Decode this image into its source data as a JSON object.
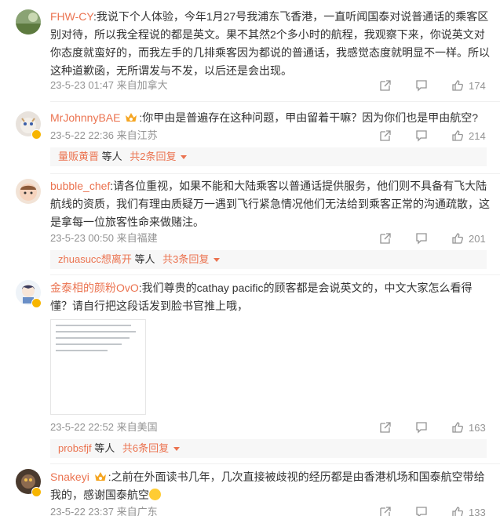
{
  "comments": [
    {
      "username": "FHW-CY",
      "text": ":我说下个人体验，今年1月27号我浦东飞香港，一直听闻国泰对说普通话的乘客区别对待，所以我全程说的都是英文。果不其然2个多小时的航程，我观察下来，你说英文对你态度就蛮好的，而我左手的几排乘客因为都说的普通话，我感觉态度就明显不一样。所以这种道歉函，无所谓发与不发，以后还是会出现。",
      "time": "23-5-23 01:47",
      "location": "来自加拿大",
      "likes": "174"
    },
    {
      "username": "MrJohnnyBAE",
      "text": ":你甲由是普遍存在这种问题，甲由留着干嘛？因为你们也是甲由航空?",
      "time": "23-5-22 22:36",
      "location": "来自江苏",
      "likes": "214",
      "replies": {
        "name": "量贩黄晋",
        "mid": " 等人 ",
        "more": "共2条回复"
      }
    },
    {
      "username": "bubble_chef",
      "text": ":请各位重视，如果不能和大陆乘客以普通话提供服务，他们则不具备有飞大陆航线的资质，我们有理由质疑万一遇到飞行紧急情况他们无法给到乘客正常的沟通疏散，这是拿每一位旅客性命来做赌注。",
      "time": "23-5-23 00:50",
      "location": "来自福建",
      "likes": "201",
      "replies": {
        "name": "zhuasucc想离开",
        "mid": " 等人 ",
        "more": "共3条回复"
      }
    },
    {
      "username": "金泰相的颜粉OvO",
      "text": ":我们尊贵的cathay pacific的顾客都是会说英文的，中文大家怎么看得懂？请自行把这段话发到脸书官推上哦，",
      "time": "23-5-22 22:52",
      "location": "来自美国",
      "likes": "163",
      "replies": {
        "name": "probsfjf",
        "mid": " 等人 ",
        "more": "共6条回复"
      }
    },
    {
      "username": "Snakeyi",
      "text": ":之前在外面读书几年，几次直接被歧视的经历都是由香港机场和国泰航空带给我的，感谢国泰航空",
      "time": "23-5-22 23:37",
      "location": "来自广东",
      "likes": "133"
    }
  ],
  "colors": {
    "accent": "#eb7350",
    "meta": "#939393",
    "reply_bg": "#f7f7f7"
  },
  "icons": {
    "share": "share-icon",
    "comment": "comment-icon",
    "like": "like-icon",
    "crown": "crown-icon",
    "more": "chevron-down-icon"
  }
}
